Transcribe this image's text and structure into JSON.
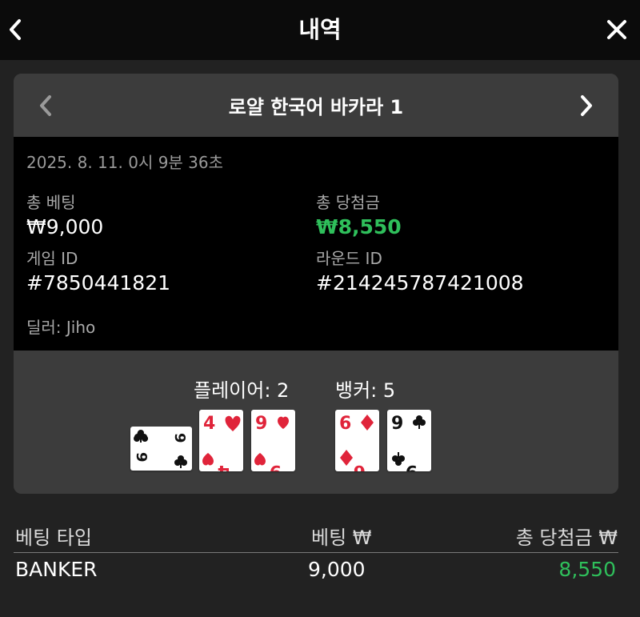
{
  "header": {
    "title": "내역"
  },
  "game": {
    "name": "로얄 한국어 바카라 1",
    "datetime": "2025. 8. 11. 0시 9분 36초",
    "total_bet_label": "총 베팅",
    "total_bet_value": "₩9,000",
    "total_win_label": "총 당첨금",
    "total_win_value": "₩8,550",
    "game_id_label": "게임 ID",
    "game_id_value": "#7850441821",
    "round_id_label": "라운드 ID",
    "round_id_value": "#214245787421008",
    "dealer": "딜러: Jiho"
  },
  "result": {
    "player_label": "플레이어: 2",
    "banker_label": "뱅커: 5",
    "player_cards": [
      {
        "rank": "9",
        "suit": "clubs",
        "orientation": "sideways"
      },
      {
        "rank": "4",
        "suit": "hearts"
      },
      {
        "rank": "9",
        "suit": "hearts"
      }
    ],
    "banker_cards": [
      {
        "rank": "6",
        "suit": "diamonds"
      },
      {
        "rank": "9",
        "suit": "clubs"
      }
    ]
  },
  "bets_table": {
    "headers": [
      "베팅 타입",
      "베팅 ₩",
      "총 당첨금 ₩"
    ],
    "rows": [
      {
        "type": "BANKER",
        "bet": "9,000",
        "win": "8,550"
      }
    ]
  },
  "colors": {
    "win_green": "#2fbf5b",
    "card_red": "#e0243a",
    "panel": "#3c3c3c"
  }
}
